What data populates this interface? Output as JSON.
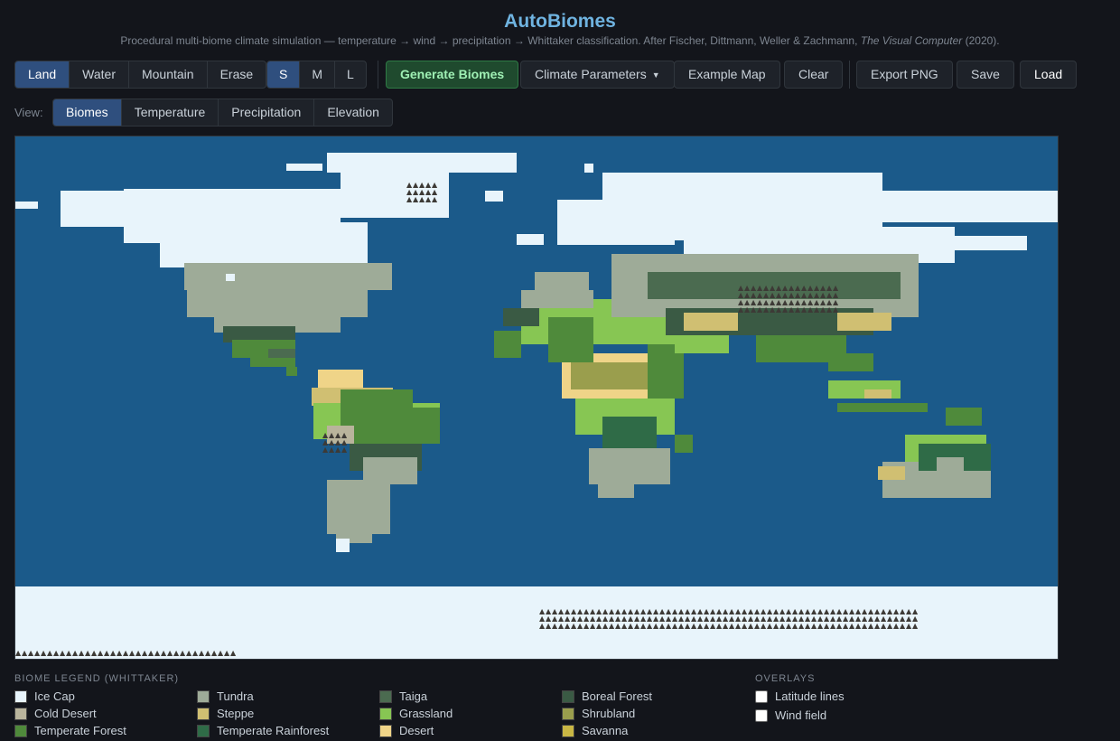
{
  "app": {
    "title": "AutoBiomes",
    "subtitle_pre": "Procedural multi-biome climate simulation — temperature → wind → precipitation → Whittaker classification. After Fischer, Dittmann, Weller & Zachmann, ",
    "subtitle_em": "The Visual Computer",
    "subtitle_post": " (2020)."
  },
  "toolbar": {
    "paint_modes": [
      "Land",
      "Water",
      "Mountain",
      "Erase"
    ],
    "active_paint": "Land",
    "brush_sizes": [
      "S",
      "M",
      "L"
    ],
    "active_brush": "S",
    "generate_label": "Generate Biomes",
    "climate_label": "Climate Parameters",
    "example_label": "Example Map",
    "clear_label": "Clear",
    "export_label": "Export PNG",
    "save_label": "Save",
    "load_label": "Load"
  },
  "view": {
    "label": "View:",
    "modes": [
      "Biomes",
      "Temperature",
      "Precipitation",
      "Elevation"
    ],
    "active": "Biomes"
  },
  "legend": {
    "heading": "BIOME LEGEND (WHITTAKER)",
    "items": [
      {
        "name": "Ice Cap",
        "color": "#e8f4fb"
      },
      {
        "name": "Tundra",
        "color": "#9eab98"
      },
      {
        "name": "Taiga",
        "color": "#4b6b50"
      },
      {
        "name": "Boreal Forest",
        "color": "#3a5a44"
      },
      {
        "name": "Cold Desert",
        "color": "#b9b49c"
      },
      {
        "name": "Steppe",
        "color": "#d0bf72"
      },
      {
        "name": "Grassland",
        "color": "#87c653"
      },
      {
        "name": "Shrubland",
        "color": "#9a9e4d"
      },
      {
        "name": "Temperate Forest",
        "color": "#4f8a3b"
      },
      {
        "name": "Temperate Rainforest",
        "color": "#2f6b47"
      },
      {
        "name": "Desert",
        "color": "#efd488"
      },
      {
        "name": "Savanna",
        "color": "#c9b744"
      }
    ]
  },
  "overlays": {
    "heading": "OVERLAYS",
    "items": [
      {
        "label": "Latitude lines",
        "checked": false
      },
      {
        "label": "Wind field",
        "checked": false
      }
    ]
  },
  "map": {
    "ocean_color": "#1b5a8a",
    "mountain_glyph": "▲",
    "mountain_color": "#3d3a36"
  }
}
